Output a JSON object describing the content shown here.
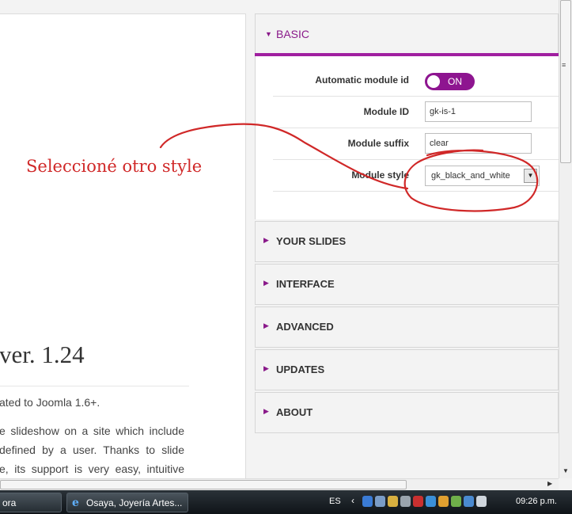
{
  "left": {
    "version_title": "ver. 1.24",
    "paragraph1": "ated to Joomla 1.6+.",
    "paragraph2_lines": [
      "e slideshow on a site which include",
      "defined by a user. Thanks to slide",
      "e, its support is very easy, intuitive"
    ]
  },
  "basic": {
    "title": "BASIC",
    "fields": {
      "auto_id_label": "Automatic module id",
      "auto_id_toggle": "ON",
      "module_id_label": "Module ID",
      "module_id_value": "gk-is-1",
      "suffix_label": "Module suffix",
      "suffix_value": "clear",
      "style_label": "Module style",
      "style_value": "gk_black_and_white"
    }
  },
  "sections": [
    {
      "title": "YOUR SLIDES"
    },
    {
      "title": "INTERFACE"
    },
    {
      "title": "ADVANCED"
    },
    {
      "title": "UPDATES"
    },
    {
      "title": "ABOUT"
    }
  ],
  "annotation": {
    "text": "Seleccioné otro style",
    "color": "#d02828"
  },
  "taskbar": {
    "task1": "ora",
    "task2": "Osaya, Joyería Artes...",
    "lang": "ES",
    "clock": "09:26 p.m."
  },
  "colors": {
    "accent": "#8e1590",
    "header_text": "#8a1a8a"
  }
}
